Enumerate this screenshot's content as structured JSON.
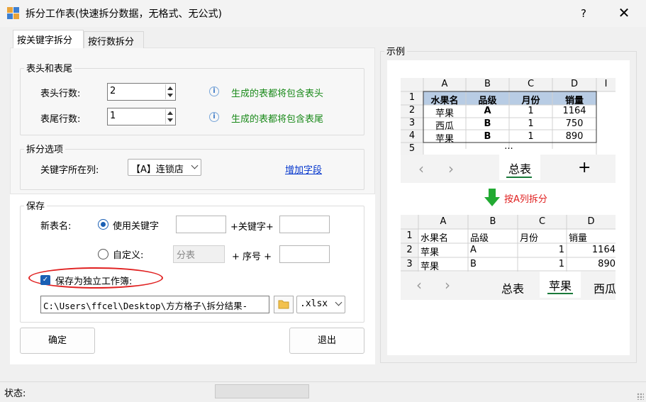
{
  "window": {
    "title": "拆分工作表(快速拆分数据，无格式、无公式)",
    "help": "?",
    "close": "✕"
  },
  "tabs": [
    {
      "label": "按关键字拆分"
    },
    {
      "label": "按行数拆分"
    }
  ],
  "header_footer": {
    "group": "表头和表尾",
    "header_label": "表头行数:",
    "header_value": "2",
    "header_hint": "生成的表都将包含表头",
    "footer_label": "表尾行数:",
    "footer_value": "1",
    "footer_hint": "生成的表都将包含表尾"
  },
  "split_options": {
    "group": "拆分选项",
    "key_col_label": "关键字所在列:",
    "key_col_value": "【A】连锁店",
    "add_field": "增加字段"
  },
  "save": {
    "group": "保存",
    "new_name_label": "新表名:",
    "use_key": "使用关键字",
    "plus_key": "+关键字+",
    "custom": "自定义:",
    "custom_placeholder": "分表",
    "plus_seq": "+ 序号 +",
    "save_wb": "保存为独立工作簿:",
    "path": "C:\\Users\\ffcel\\Desktop\\方方格子\\拆分结果-",
    "ext": ".xlsx"
  },
  "buttons": {
    "ok": "确定",
    "exit": "退出"
  },
  "status": {
    "label": "状态:"
  },
  "example": {
    "group": "示例",
    "top": {
      "cols": [
        "A",
        "B",
        "C",
        "D"
      ],
      "rows": [
        "1",
        "2",
        "3",
        "4",
        "5"
      ],
      "header": [
        "水果名",
        "品级",
        "月份",
        "销量"
      ],
      "data": [
        [
          "苹果",
          "A",
          "1",
          "1164"
        ],
        [
          "西瓜",
          "B",
          "1",
          "750"
        ],
        [
          "苹果",
          "B",
          "1",
          "890"
        ]
      ],
      "ellipsis": "...",
      "sheet_tab": "总表",
      "add": "+",
      "nav_prev": "‹",
      "nav_next": "›"
    },
    "arrow_label": "按A列拆分",
    "bottom": {
      "cols": [
        "A",
        "B",
        "C",
        "D"
      ],
      "rows": [
        "1",
        "2",
        "3"
      ],
      "header": [
        "水果名",
        "品级",
        "月份",
        "销量"
      ],
      "data": [
        [
          "苹果",
          "A",
          "1",
          "1164"
        ],
        [
          "苹果",
          "B",
          "1",
          "890"
        ]
      ],
      "tabs": [
        "总表",
        "苹果",
        "西瓜"
      ],
      "nav_prev": "‹",
      "nav_next": "›"
    }
  },
  "colors": {
    "accent": "#1a5fb4",
    "hint_green": "#1a8a1a",
    "highlight_red": "#e02020",
    "header_blue": "#b8cce4",
    "arrow_green": "#22aa33"
  }
}
